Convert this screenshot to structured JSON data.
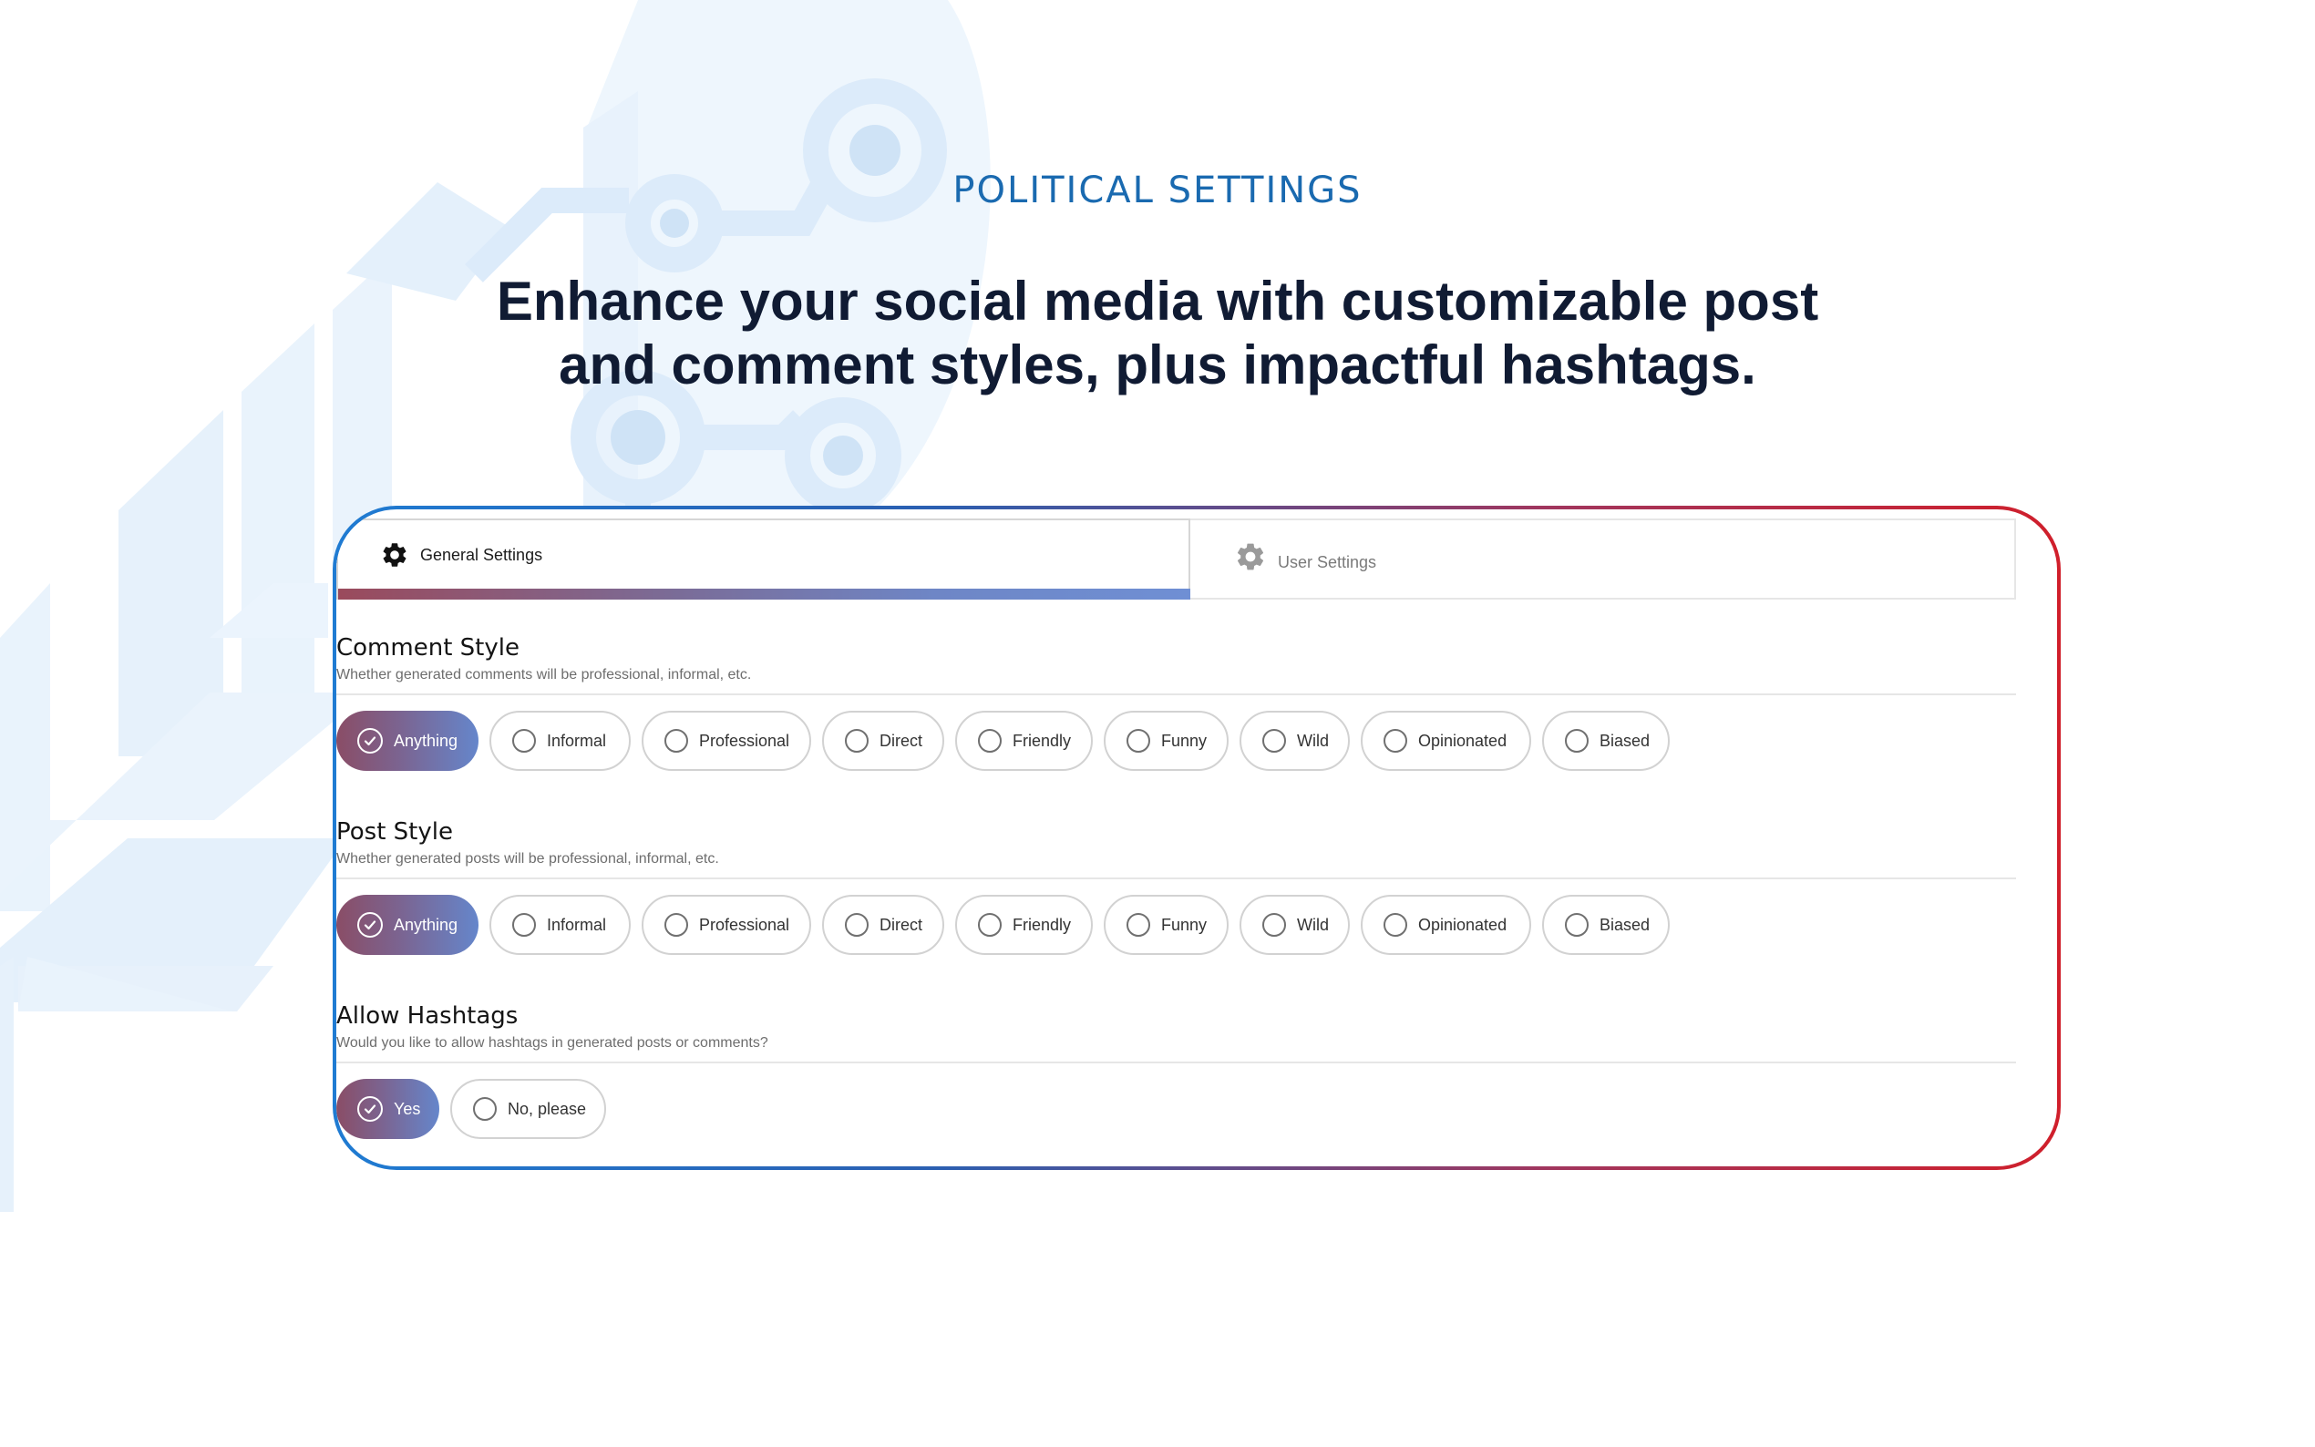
{
  "header": {
    "eyebrow": "POLITICAL SETTINGS",
    "headline_line1": "Enhance your social media with customizable post",
    "headline_line2": "and comment styles, plus impactful hashtags."
  },
  "tabs": {
    "general_label": "General Settings",
    "user_label": "User Settings",
    "active": "General Settings"
  },
  "comment_style": {
    "title": "Comment Style",
    "description": "Whether generated comments will be professional, informal, etc.",
    "options": [
      "Anything",
      "Informal",
      "Professional",
      "Direct",
      "Friendly",
      "Funny",
      "Wild",
      "Opinionated",
      "Biased"
    ],
    "selected": "Anything"
  },
  "post_style": {
    "title": "Post Style",
    "description": "Whether generated posts will be professional, informal, etc.",
    "options": [
      "Anything",
      "Informal",
      "Professional",
      "Direct",
      "Friendly",
      "Funny",
      "Wild",
      "Opinionated",
      "Biased"
    ],
    "selected": "Anything"
  },
  "hashtags": {
    "title": "Allow Hashtags",
    "description": "Would you like to allow hashtags in generated posts or comments?",
    "options": [
      "Yes",
      "No, please"
    ],
    "selected": "Yes"
  },
  "colors": {
    "eyebrow": "#1a6ab0",
    "headline": "#101b33",
    "frame_left": "#1f7bd2",
    "frame_right": "#d01f2b",
    "selected_start": "#8a4d66",
    "selected_end": "#6586cb"
  },
  "icons": {
    "general_tab": "gear-icon",
    "user_tab": "gear-icon",
    "selected": "check-circle-icon",
    "unselected": "radio-empty-icon"
  }
}
